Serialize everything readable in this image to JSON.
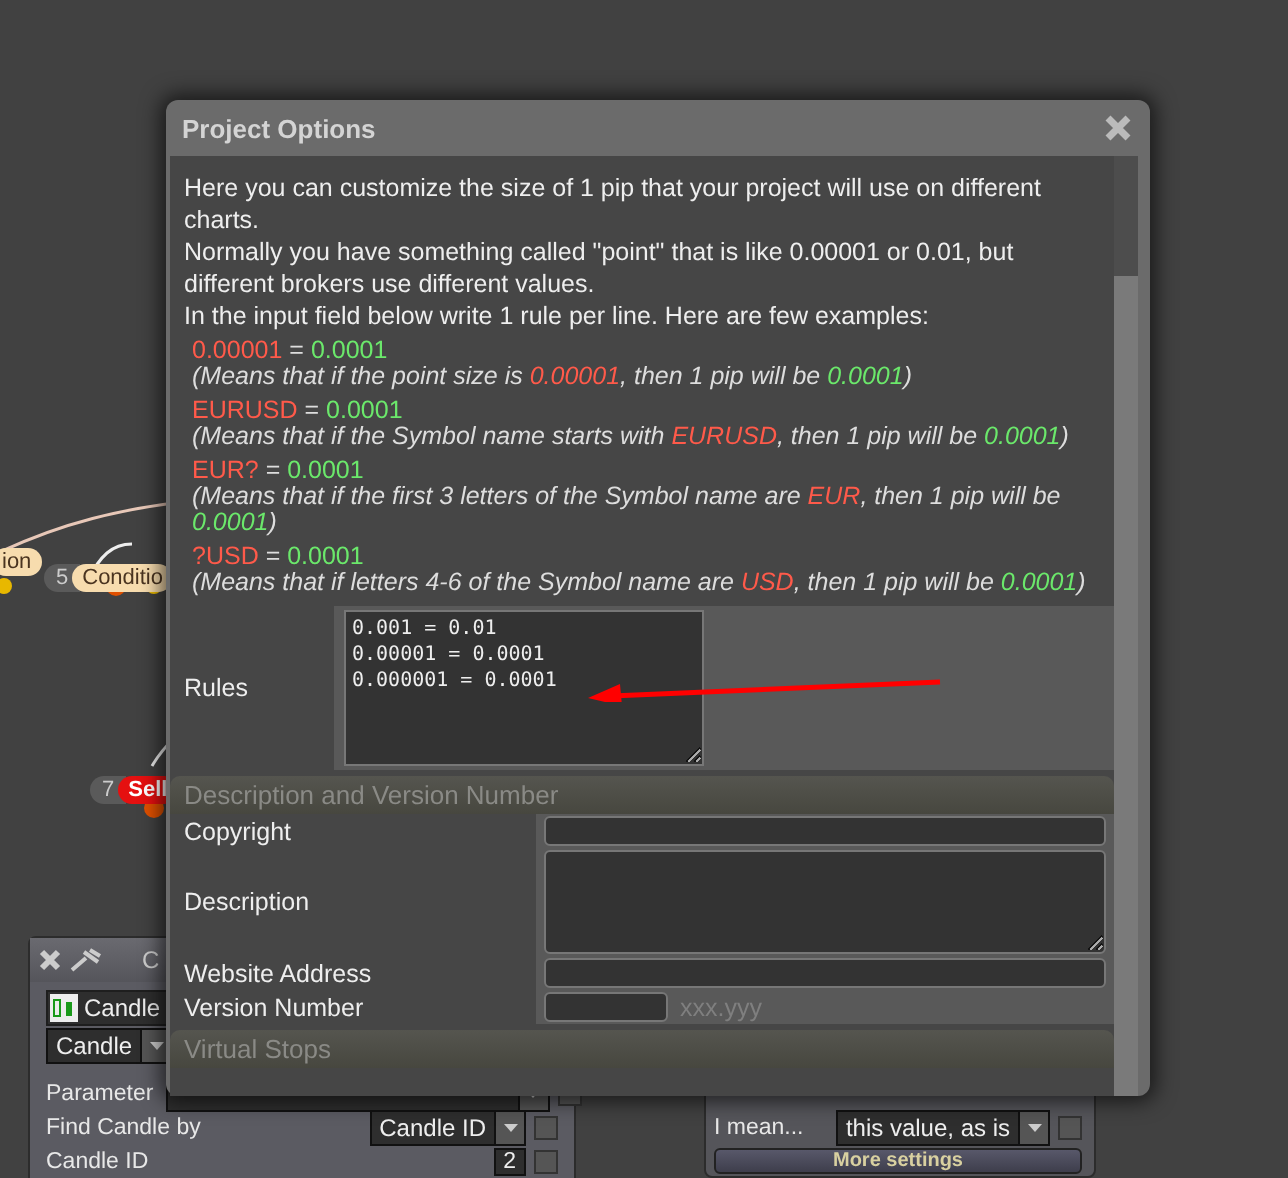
{
  "canvas": {
    "nodes": [
      {
        "label": "ion",
        "kind": "condition"
      },
      {
        "number": "5",
        "label": "Conditio",
        "kind": "condition"
      },
      {
        "number": "7",
        "label": "Sell",
        "kind": "action"
      }
    ]
  },
  "block_panel": {
    "title": "C",
    "block": "Candle",
    "selector": "Candle",
    "rows": [
      {
        "label": "Parameter",
        "kind": "select",
        "checked": false
      },
      {
        "label": "Find Candle by",
        "kind": "select",
        "value": "Candle ID",
        "checked": false
      },
      {
        "label": "Candle ID",
        "kind": "number",
        "value": "2",
        "checked": false
      }
    ]
  },
  "side_panel": {
    "rows": [
      {
        "label": "I mean...",
        "value": "this value, as is",
        "checked": false
      }
    ],
    "button": "More settings"
  },
  "dialog": {
    "title": "Project Options",
    "intro": [
      "Here you can customize the size of 1 pip that your project will use on different charts.",
      "Normally you have something called \"point\" that is like 0.00001 or 0.01, but different brokers use different values.",
      "In the input field below write 1 rule per line. Here are few examples:"
    ],
    "examples": [
      {
        "rule": [
          {
            "kind": "pattern",
            "text": "0.00001"
          },
          {
            "kind": "plain",
            "text": " = "
          },
          {
            "kind": "value",
            "text": "0.0001"
          }
        ],
        "note": [
          {
            "kind": "plain",
            "text": "(Means that if the point size is "
          },
          {
            "kind": "pattern",
            "text": "0.00001"
          },
          {
            "kind": "plain",
            "text": ", then 1 pip will be "
          },
          {
            "kind": "value",
            "text": "0.0001"
          },
          {
            "kind": "plain",
            "text": ")"
          }
        ]
      },
      {
        "rule": [
          {
            "kind": "pattern",
            "text": "EURUSD"
          },
          {
            "kind": "plain",
            "text": " = "
          },
          {
            "kind": "value",
            "text": "0.0001"
          }
        ],
        "note": [
          {
            "kind": "plain",
            "text": "(Means that if the Symbol name starts with "
          },
          {
            "kind": "pattern",
            "text": "EURUSD"
          },
          {
            "kind": "plain",
            "text": ", then 1 pip will be "
          },
          {
            "kind": "value",
            "text": "0.0001"
          },
          {
            "kind": "plain",
            "text": ")"
          }
        ]
      },
      {
        "rule": [
          {
            "kind": "pattern",
            "text": "EUR?"
          },
          {
            "kind": "plain",
            "text": " = "
          },
          {
            "kind": "value",
            "text": "0.0001"
          }
        ],
        "note": [
          {
            "kind": "plain",
            "text": "(Means that if the first 3 letters of the Symbol name are "
          },
          {
            "kind": "pattern",
            "text": "EUR"
          },
          {
            "kind": "plain",
            "text": ", then 1 pip will be "
          },
          {
            "kind": "value",
            "text": "0.0001"
          },
          {
            "kind": "plain",
            "text": ")"
          }
        ]
      },
      {
        "rule": [
          {
            "kind": "pattern",
            "text": "?USD"
          },
          {
            "kind": "plain",
            "text": " = "
          },
          {
            "kind": "value",
            "text": "0.0001"
          }
        ],
        "note": [
          {
            "kind": "plain",
            "text": "(Means that if letters 4-6 of the Symbol name are "
          },
          {
            "kind": "pattern",
            "text": "USD"
          },
          {
            "kind": "plain",
            "text": ", then 1 pip will be "
          },
          {
            "kind": "value",
            "text": "0.0001"
          },
          {
            "kind": "plain",
            "text": ")"
          }
        ]
      }
    ],
    "rules": {
      "label": "Rules",
      "value": "0.001 = 0.01\n0.00001 = 0.0001\n0.000001 = 0.0001"
    },
    "sections": [
      {
        "title": "Description and Version Number",
        "fields": [
          {
            "label": "Copyright",
            "kind": "line"
          },
          {
            "label": "Description",
            "kind": "area"
          },
          {
            "label": "Website Address",
            "kind": "line"
          },
          {
            "label": "Version Number",
            "kind": "short",
            "hint": "xxx.yyy"
          }
        ]
      },
      {
        "title": "Virtual Stops"
      }
    ]
  }
}
